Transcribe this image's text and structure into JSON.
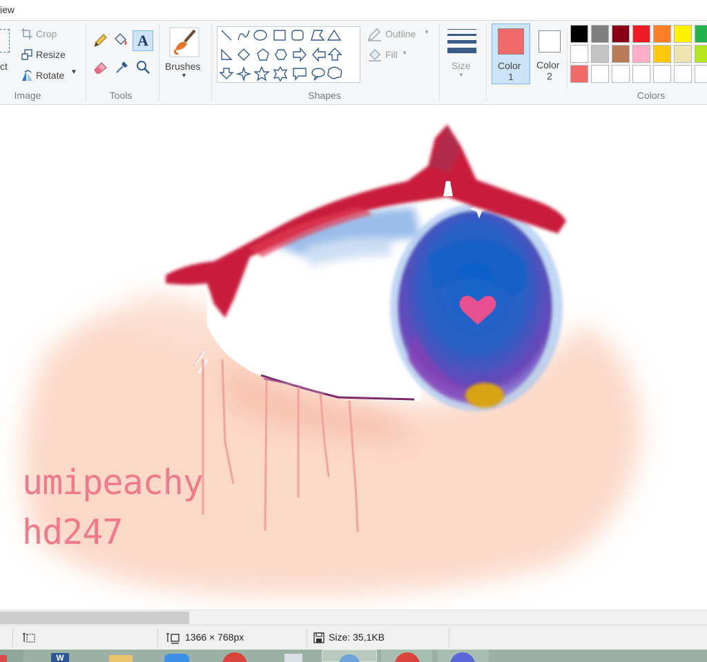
{
  "tabstrip": {
    "view_tab": "iew"
  },
  "image_group": {
    "label": "Image",
    "select_label": "ct",
    "crop": "Crop",
    "resize": "Resize",
    "rotate": "Rotate"
  },
  "tools_group": {
    "label": "Tools",
    "text_tool": "A"
  },
  "brushes": {
    "label": "Brushes"
  },
  "shapes_group": {
    "label": "Shapes",
    "outline": "Outline",
    "fill": "Fill"
  },
  "size": {
    "label": "Size"
  },
  "color1": {
    "label": "Color",
    "number": "1",
    "color": "#f2696a"
  },
  "color2": {
    "label": "Color",
    "number": "2",
    "color": "#ffffff"
  },
  "colors_group": {
    "label": "Colors",
    "palette_rows": [
      [
        "#000000",
        "#7f7f7f",
        "#880015",
        "#ed1c24",
        "#ff7f27",
        "#fff200",
        "#22b14c"
      ],
      [
        "#ffffff",
        "#c3c3c3",
        "#b97a57",
        "#ffaec9",
        "#ffc90e",
        "#efe4b0",
        "#b5e61d"
      ],
      [
        "#f2696a",
        "#ffffff",
        "#ffffff",
        "#ffffff",
        "#ffffff",
        "#ffffff",
        "#ffffff"
      ]
    ]
  },
  "canvas": {
    "line1": "umipeachy",
    "line2": "hd247",
    "watermark_color": "#f07a8c"
  },
  "statusbar": {
    "dimensions": "1366 × 768px",
    "size": "Size: 35,1KB"
  }
}
